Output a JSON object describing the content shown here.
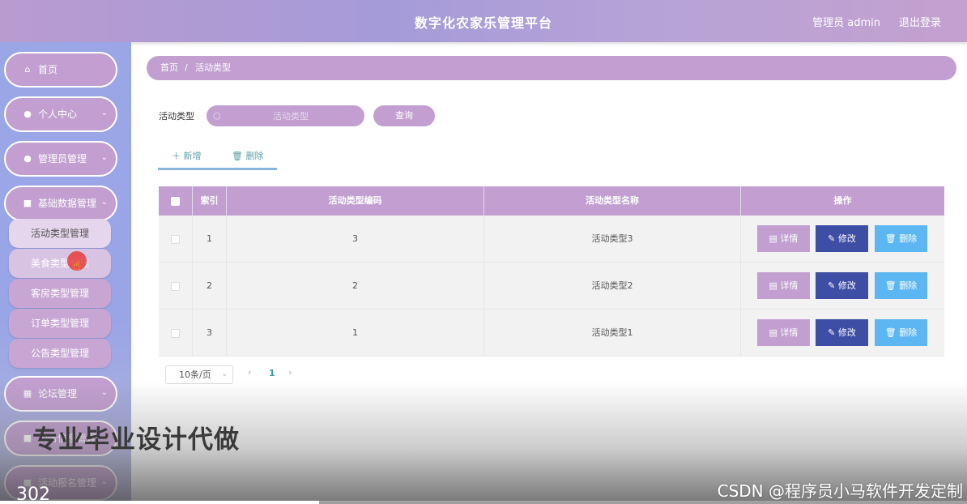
{
  "header": {
    "title": "数字化农家乐管理平台",
    "admin": "管理员 admin",
    "logout": "退出登录"
  },
  "sidebar": {
    "items": [
      {
        "label": "首页",
        "icon": "home-icon",
        "glyph": "⌂"
      },
      {
        "label": "个人中心",
        "icon": "user-icon",
        "glyph": "●",
        "arrow": "⌄"
      },
      {
        "label": "管理员管理",
        "icon": "admin-user-icon",
        "glyph": "●",
        "arrow": "⌄"
      },
      {
        "label": "基础数据管理",
        "icon": "briefcase-icon",
        "glyph": "■",
        "arrow": "⌄"
      },
      {
        "label": "论坛管理",
        "icon": "grid-icon",
        "glyph": "▦",
        "arrow": "⌄"
      },
      {
        "label": "公告信息管理",
        "icon": "notice-icon",
        "glyph": "■",
        "arrow": "⌄"
      },
      {
        "label": "活动报名管理",
        "icon": "list-icon",
        "glyph": "■",
        "arrow": "⌄"
      }
    ],
    "submenu": [
      "活动类型管理",
      "美食类型管理",
      "客房类型管理",
      "订单类型管理",
      "公告类型管理"
    ]
  },
  "breadcrumb": {
    "home": "首页",
    "sep": "/",
    "current": "活动类型"
  },
  "search": {
    "label": "活动类型",
    "placeholder": "活动类型",
    "button": "查询",
    "icon": "search-icon"
  },
  "toolbar": {
    "add": "＋ 新增",
    "delete": "🗑 删除"
  },
  "table": {
    "columns": [
      "索引",
      "活动类型编码",
      "活动类型名称",
      "操作"
    ],
    "rows": [
      {
        "index": "1",
        "code": "3",
        "name": "活动类型3"
      },
      {
        "index": "2",
        "code": "2",
        "name": "活动类型2"
      },
      {
        "index": "3",
        "code": "1",
        "name": "活动类型1"
      }
    ],
    "actions": {
      "detail": "▤ 详情",
      "edit": "✎ 修改",
      "delete": "🗑 删除"
    }
  },
  "pagination": {
    "page_size": "10条/页",
    "arrow_down": "⌄",
    "prev": "‹",
    "current": "1",
    "next": "›"
  },
  "overlay": {
    "promo": "专业毕业设计代做",
    "csdn": "CSDN @程序员小马软件开发定制",
    "time": "302",
    "progress": 0.33
  },
  "colors": {
    "accent": "#c29fd0",
    "edit": "#3e4ea5",
    "delete": "#5bb6f2"
  }
}
